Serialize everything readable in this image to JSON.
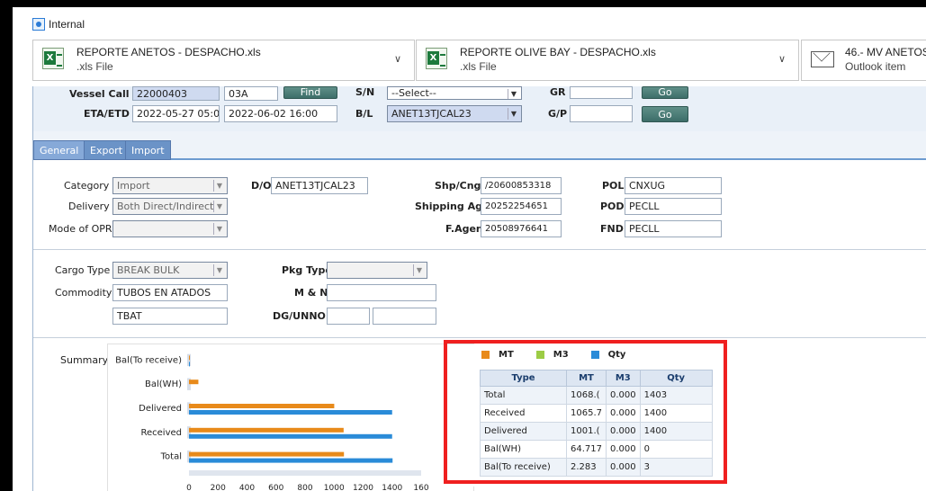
{
  "header": {
    "internal_label": "Internal"
  },
  "attachments": [
    {
      "name": "REPORTE ANETOS - DESPACHO.xls",
      "type": ".xls File"
    },
    {
      "name": "REPORTE OLIVE BAY - DESPACHO.xls",
      "type": ".xls File"
    },
    {
      "name": "46.- MV ANETOS --",
      "type": "Outlook item"
    }
  ],
  "vessel": {
    "vessel_call_label": "Vessel Call ID",
    "vessel_call_value": "22000403",
    "vessel_call_suffix": "03A",
    "find_button": "Find",
    "eta_label": "ETA/ETD",
    "eta_value": "2022-05-27 05:00",
    "etd_value": "2022-06-02 16:00",
    "sn_label": "S/N",
    "sn_value": "--Select--",
    "bl_label": "B/L",
    "bl_value": "ANET13TJCAL23",
    "gr_label": "GR",
    "gp_label": "G/P",
    "go_button": "Go"
  },
  "tabs": [
    {
      "label": "General"
    },
    {
      "label": "Export"
    },
    {
      "label": "Import"
    }
  ],
  "general": {
    "category_label": "Category",
    "category_value": "Import",
    "delivery_label": "Delivery",
    "delivery_value": "Both Direct/Indirect",
    "mode_label": "Mode of OPR.",
    "mode_value": "",
    "do_label": "D/O",
    "do_value": "ANET13TJCAL23",
    "shp_label": "Shp/Cng",
    "shp_value": "/20600853318",
    "agent_label": "Shipping Agent",
    "agent_value": "20252254651",
    "fagent_label": "F.Agent",
    "fagent_value": "20508976641",
    "pol_label": "POL",
    "pol_value": "CNXUG",
    "pod_label": "POD",
    "pod_value": "PECLL",
    "fnd_label": "FND",
    "fnd_value": "PECLL"
  },
  "cargo": {
    "cargo_type_label": "Cargo Type",
    "cargo_type_value": "BREAK BULK",
    "pkg_type_label": "Pkg Type",
    "pkg_type_value": "",
    "commodity_label": "Commodity",
    "commodity_value": "TUBOS EN ATADOS",
    "commodity_code": "TBAT",
    "mn_label": "M & N",
    "dg_label": "DG/UNNO"
  },
  "summary": {
    "label": "Summary",
    "legend": [
      {
        "name": "MT",
        "color": "#e88a1a"
      },
      {
        "name": "M3",
        "color": "#9ccc45"
      },
      {
        "name": "Qty",
        "color": "#2a8bd8"
      }
    ],
    "table_headers": [
      "Type",
      "MT",
      "M3",
      "Qty"
    ],
    "rows": [
      {
        "type": "Total",
        "mt": "1068.(",
        "m3": "0.000",
        "qty": "1403"
      },
      {
        "type": "Received",
        "mt": "1065.7",
        "m3": "0.000",
        "qty": "1400"
      },
      {
        "type": "Delivered",
        "mt": "1001.(",
        "m3": "0.000",
        "qty": "1400"
      },
      {
        "type": "Bal(WH)",
        "mt": "64.717",
        "m3": "0.000",
        "qty": "0"
      },
      {
        "type": "Bal(To receive)",
        "mt": "2.283",
        "m3": "0.000",
        "qty": "3"
      }
    ]
  },
  "chart_data": {
    "type": "bar",
    "orientation": "horizontal",
    "categories": [
      "Bal(To receive)",
      "Bal(WH)",
      "Delivered",
      "Received",
      "Total"
    ],
    "series": [
      {
        "name": "MT",
        "color": "#e88a1a",
        "values": [
          2.283,
          64.717,
          1001,
          1065.7,
          1068
        ]
      },
      {
        "name": "M3",
        "color": "#9ccc45",
        "values": [
          0,
          0,
          0,
          0,
          0
        ]
      },
      {
        "name": "Qty",
        "color": "#2a8bd8",
        "values": [
          3,
          0,
          1400,
          1400,
          1403
        ]
      }
    ],
    "x_ticks": [
      "0",
      "200",
      "400",
      "600",
      "800",
      "1000",
      "1200",
      "1400",
      "160"
    ],
    "xlim": [
      0,
      1600
    ]
  }
}
